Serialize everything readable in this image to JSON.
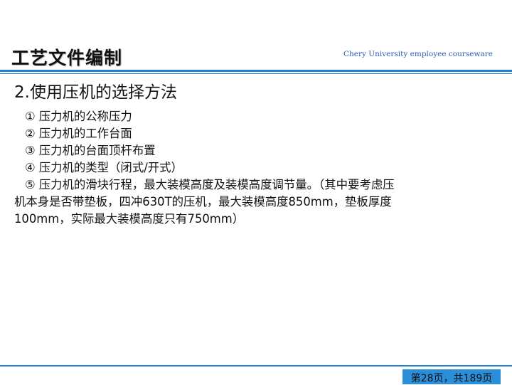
{
  "header": {
    "title": "工艺文件编制",
    "brand": "Chery University employee courseware"
  },
  "content": {
    "heading": "2.使用压机的选择方法",
    "items": [
      {
        "num": "①",
        "text": "压力机的公称压力"
      },
      {
        "num": "②",
        "text": "压力机的工作台面"
      },
      {
        "num": "③",
        "text": "压力机的台面顶杆布置"
      },
      {
        "num": "④",
        "text": "压力机的类型（闭式/开式）"
      },
      {
        "num": "⑤",
        "text": "压力机的滑块行程，最大装模高度及装模高度调节量。（其中要考虑压"
      }
    ],
    "continuation": [
      "机本身是否带垫板，四冲630T的压机，最大装模高度850mm，垫板厚度",
      "100mm，实际最大装模高度只有750mm）"
    ]
  },
  "footer": {
    "page_label": "第28页，共189页"
  },
  "colors": {
    "accent": "#1f7fd0",
    "brand_text": "#2b5db8",
    "footer_box": "#2a8fd8"
  }
}
